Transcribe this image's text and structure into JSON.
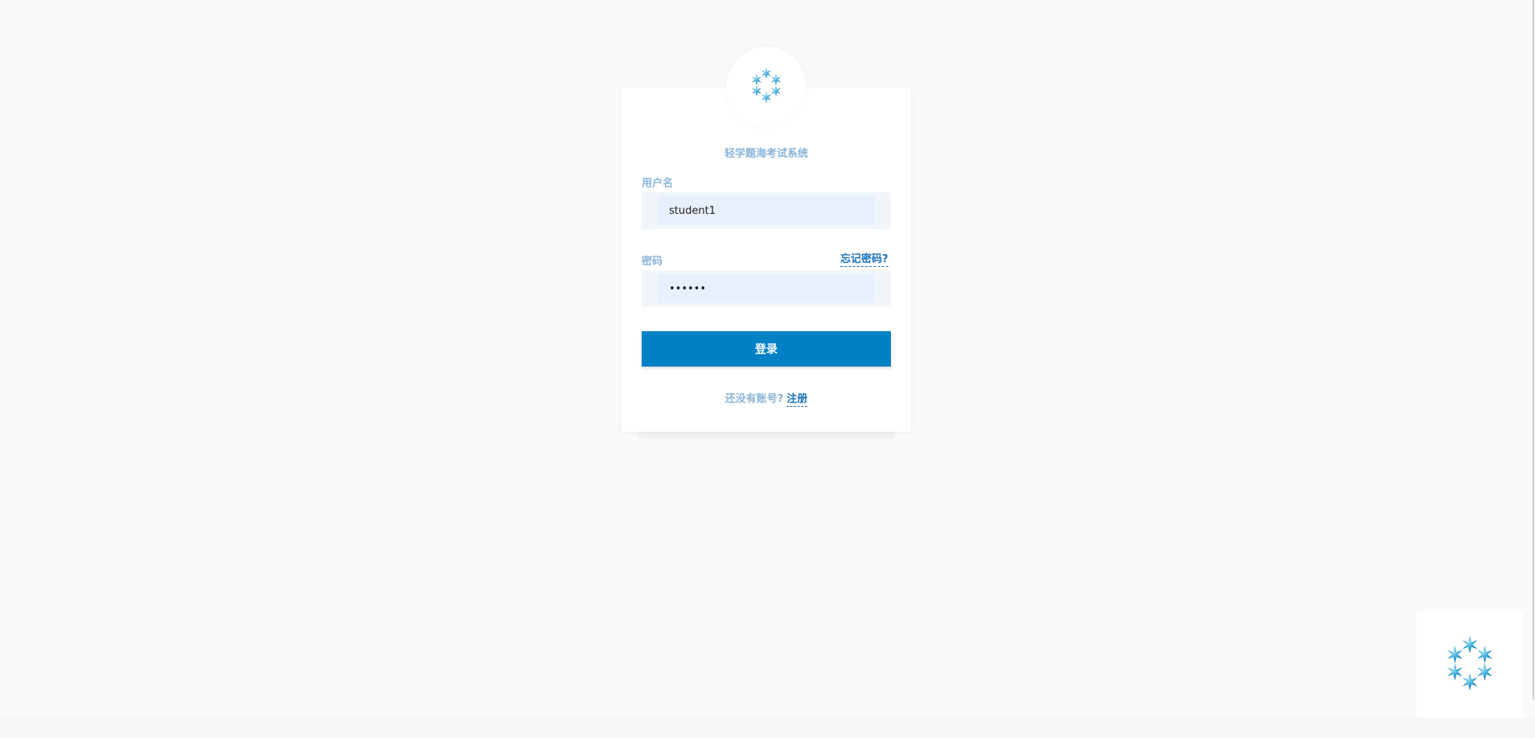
{
  "app": {
    "title": "轻学题海考试系统",
    "logo_icon": "snowflake-cluster-icon"
  },
  "form": {
    "username_label": "用户名",
    "username_value": "student1",
    "password_label": "密码",
    "password_value": "••••••",
    "forgot_label": "忘记密码?",
    "login_label": "登录",
    "register_prompt": "还没有账号?",
    "register_label": "注册"
  },
  "corner_widget": {
    "icon": "snowflake-cluster-icon"
  },
  "colors": {
    "accent": "#0081c6",
    "link": "#1a72b8",
    "label": "#8ab5d8",
    "input_bg": "#e8f0fe",
    "page_bg": "#fafafa"
  }
}
